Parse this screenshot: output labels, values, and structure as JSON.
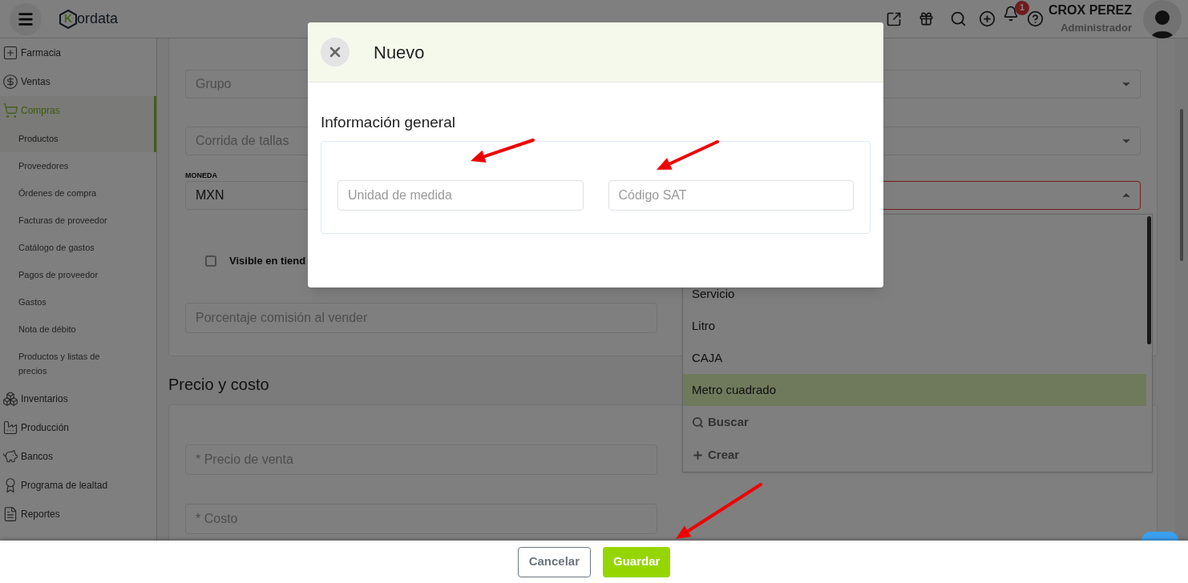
{
  "header": {
    "logo": {
      "mark": "K",
      "text": "ordata"
    },
    "notifications_badge": "1",
    "user": {
      "name": "CROX PEREZ",
      "role": "Administrador"
    }
  },
  "sidebar": {
    "items": [
      {
        "kind": "pharmacy",
        "label": "Farmacia",
        "selected": false
      },
      {
        "kind": "sales",
        "label": "Ventas",
        "selected": false
      },
      {
        "kind": "purchases",
        "label": "Compras",
        "selected": true,
        "expanded": true,
        "children": [
          {
            "label": "Productos",
            "selected": true
          },
          {
            "label": "Proveedores",
            "selected": false
          },
          {
            "label": "Órdenes de compra",
            "selected": false
          },
          {
            "label": "Facturas de proveedor",
            "selected": false
          },
          {
            "label": "Catálogo de gastos",
            "selected": false
          },
          {
            "label": "Pagos de proveedor",
            "selected": false
          },
          {
            "label": "Gastos",
            "selected": false
          },
          {
            "label": "Nota de débito",
            "selected": false
          },
          {
            "label": "Productos y listas de precios",
            "selected": false
          }
        ]
      },
      {
        "kind": "inventory",
        "label": "Inventarios",
        "selected": false
      },
      {
        "kind": "production",
        "label": "Producción",
        "selected": false
      },
      {
        "kind": "banks",
        "label": "Bancos",
        "selected": false
      },
      {
        "kind": "loyalty",
        "label": "Programa de lealtad",
        "selected": false
      },
      {
        "kind": "reports",
        "label": "Reportes",
        "selected": false
      }
    ]
  },
  "general": {
    "group_field": {
      "placeholder": "Grupo"
    },
    "sizes_field": {
      "placeholder": "Corrida de tallas"
    },
    "currency": {
      "label": "MONEDA",
      "value": "MXN"
    },
    "unit_select": {
      "expanded": true,
      "invalid": true
    },
    "visible_checkbox": {
      "label": "Visible en tiend",
      "checked": false
    },
    "commission_field": {
      "placeholder": "Porcentaje comisión al vender"
    }
  },
  "price_section": {
    "title": "Precio y costo",
    "fields": [
      {
        "placeholder": "* Precio de venta"
      },
      {
        "placeholder": "* Costo"
      }
    ]
  },
  "unit_dropdown": {
    "options": [
      {
        "label": "Servicio",
        "selected": false
      },
      {
        "label": "Litro",
        "selected": false
      },
      {
        "label": "CAJA",
        "selected": false
      },
      {
        "label": "Metro cuadrado",
        "selected": true
      }
    ],
    "actions": [
      {
        "kind": "search",
        "label": "Buscar"
      },
      {
        "kind": "create",
        "label": "Crear"
      }
    ]
  },
  "modal": {
    "title": "Nuevo",
    "section_title": "Información general",
    "fields": [
      {
        "placeholder": "Unidad de medida"
      },
      {
        "placeholder": "Código SAT"
      }
    ]
  },
  "footer": {
    "buttons": [
      {
        "kind": "secondary",
        "label": "Cancelar"
      },
      {
        "kind": "primary",
        "label": "Guardar"
      }
    ]
  }
}
